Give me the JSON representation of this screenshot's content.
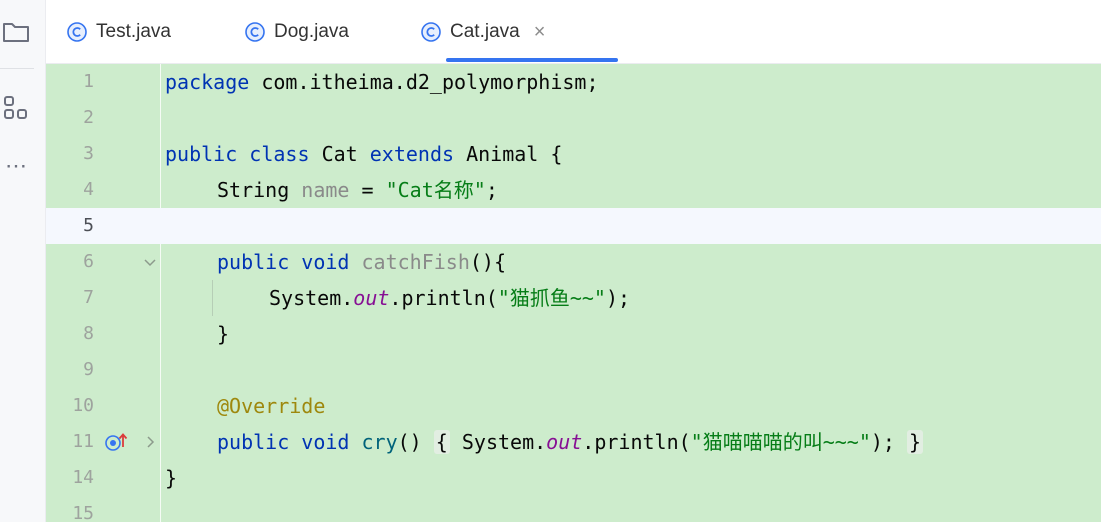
{
  "tabs": [
    {
      "label": "Test.java",
      "icon": "java-class-icon",
      "active": false
    },
    {
      "label": "Dog.java",
      "icon": "java-class-icon",
      "active": false
    },
    {
      "label": "Cat.java",
      "icon": "java-class-icon",
      "active": true,
      "close": "×"
    }
  ],
  "stripe": {
    "icons": [
      "project-folder-icon",
      "structure-icon",
      "more-tools-icon"
    ],
    "more_label": "⋯"
  },
  "editor": {
    "line_numbers": [
      "1",
      "2",
      "3",
      "4",
      "5",
      "6",
      "7",
      "8",
      "9",
      "10",
      "11",
      "14",
      "15"
    ],
    "code": {
      "l1_kw": "package",
      "l1_rest": " com.itheima.d2_polymorphism;",
      "l3_kw1": "public",
      "l3_kw2": "class",
      "l3_name": "Cat",
      "l3_kw3": "extends",
      "l3_rest": " Animal {",
      "l4_type": "String",
      "l4_var": "name",
      "l4_eq": " = ",
      "l4_str": "\"Cat名称\"",
      "l4_end": ";",
      "l6_kw1": "public",
      "l6_kw2": "void",
      "l6_method": "catchFish",
      "l6_rest": "(){",
      "l7_sys": "System.",
      "l7_out": "out",
      "l7_call": ".println(",
      "l7_str": "\"猫抓鱼~~\"",
      "l7_end": ");",
      "l8_brace": "}",
      "l10_ann": "@Override",
      "l11_kw1": "public",
      "l11_kw2": "void",
      "l11_method": " cry",
      "l11_parens": "()",
      "l11_open": "{",
      "l11_sys": "System.",
      "l11_out": "out",
      "l11_call": ".println(",
      "l11_str": "\"猫喵喵喵的叫~~~\"",
      "l11_end": ");",
      "l11_close": "}",
      "l14_brace": "}"
    },
    "colors": {
      "keyword": "#0033b3",
      "string": "#067d17",
      "field": "#871094",
      "annotation": "#9e880d",
      "background": "#cdeccc"
    }
  }
}
